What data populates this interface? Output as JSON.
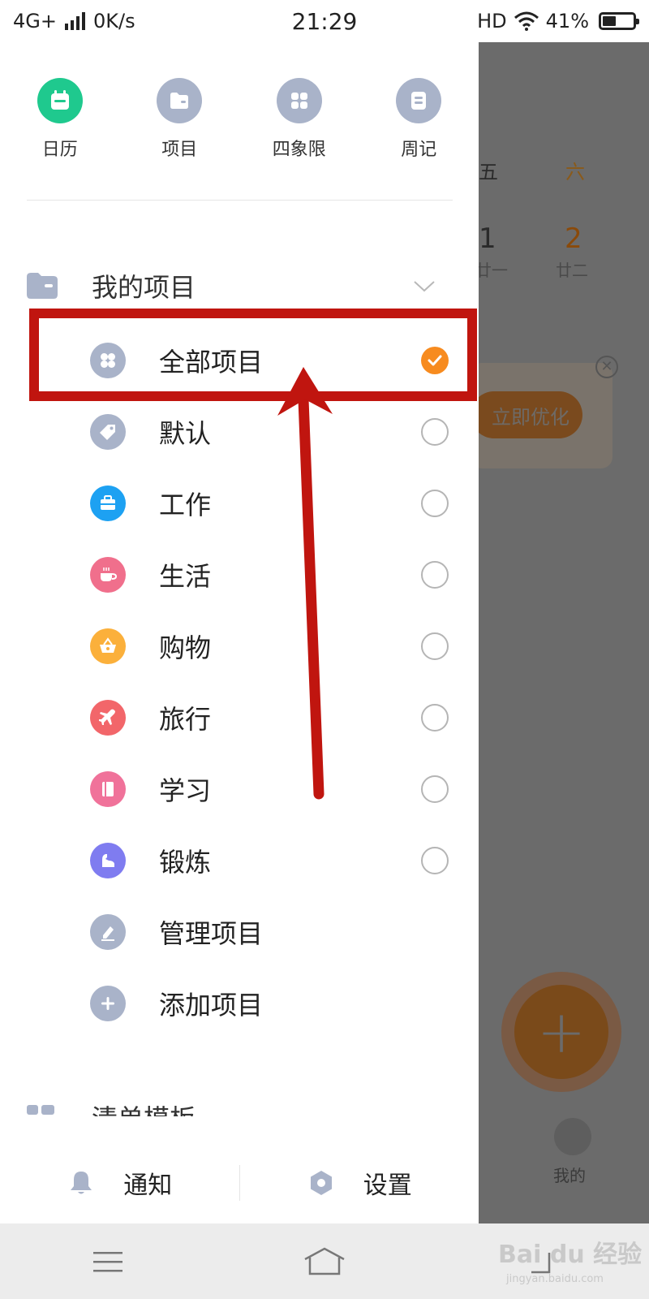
{
  "status_bar": {
    "network": "4G+",
    "speed": "0K/s",
    "time": "21:29",
    "hd": "HD",
    "battery": "41%"
  },
  "quick_nav": [
    {
      "label": "日历",
      "icon": "calendar-icon",
      "color": "#1fc98e"
    },
    {
      "label": "项目",
      "icon": "folder-icon",
      "color": "#a9b3c9"
    },
    {
      "label": "四象限",
      "icon": "grid-icon",
      "color": "#a9b3c9"
    },
    {
      "label": "周记",
      "icon": "note-icon",
      "color": "#a9b3c9"
    }
  ],
  "projects": {
    "section_title": "我的项目",
    "items": [
      {
        "label": "全部项目",
        "icon": "clover-icon",
        "color": "#a9b3c9",
        "selected": true
      },
      {
        "label": "默认",
        "icon": "tag-icon",
        "color": "#a9b3c9",
        "selected": false
      },
      {
        "label": "工作",
        "icon": "briefcase-icon",
        "color": "#1da1f2",
        "selected": false
      },
      {
        "label": "生活",
        "icon": "coffee-icon",
        "color": "#f06f8c",
        "selected": false
      },
      {
        "label": "购物",
        "icon": "basket-icon",
        "color": "#fbb03b",
        "selected": false
      },
      {
        "label": "旅行",
        "icon": "plane-icon",
        "color": "#f2666a",
        "selected": false
      },
      {
        "label": "学习",
        "icon": "book-icon",
        "color": "#f0729a",
        "selected": false
      },
      {
        "label": "锻炼",
        "icon": "muscle-icon",
        "color": "#7f7cf0",
        "selected": false
      }
    ],
    "manage_label": "管理项目",
    "add_label": "添加项目"
  },
  "templates_label": "清单模板",
  "bottom": {
    "notify_label": "通知",
    "settings_label": "设置"
  },
  "background_app": {
    "weekday_fri": "五",
    "weekday_sat": "六",
    "day_fri": "1",
    "day_sat": "2",
    "lunar_fri": "廿一",
    "lunar_sat": "廿二",
    "promo_button": "立即优化",
    "me_label": "我的"
  },
  "watermark": {
    "main": "Bai du 经验",
    "sub": "jingyan.baidu.com"
  },
  "colors": {
    "accent": "#f78b1f",
    "annotation": "#c0150f",
    "icon_grey": "#a9b3c9"
  }
}
